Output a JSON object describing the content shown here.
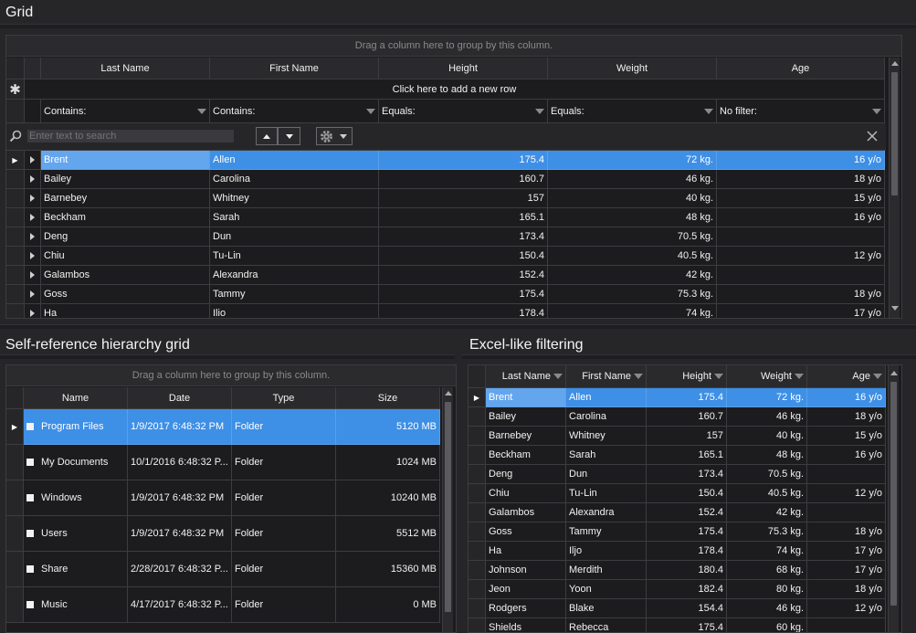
{
  "main_grid": {
    "title": "Grid",
    "group_hint": "Drag a column here to group by this column.",
    "columns": [
      "Last Name",
      "First Name",
      "Height",
      "Weight",
      "Age"
    ],
    "new_row": "Click here to add a new row",
    "filters": [
      "Contains:",
      "Contains:",
      "Equals:",
      "Equals:",
      "No filter:"
    ],
    "search_placeholder": "Enter text to search",
    "rows": [
      [
        "Brent",
        "Allen",
        "175.4",
        "72 kg.",
        "16 y/o"
      ],
      [
        "Bailey",
        "Carolina",
        "160.7",
        "46 kg.",
        "18 y/o"
      ],
      [
        "Barnebey",
        "Whitney",
        "157",
        "40 kg.",
        "15 y/o"
      ],
      [
        "Beckham",
        "Sarah",
        "165.1",
        "48 kg.",
        "16 y/o"
      ],
      [
        "Deng",
        "Dun",
        "173.4",
        "70.5 kg.",
        ""
      ],
      [
        "Chiu",
        "Tu-Lin",
        "150.4",
        "40.5 kg.",
        "12 y/o"
      ],
      [
        "Galambos",
        "Alexandra",
        "152.4",
        "42 kg.",
        ""
      ],
      [
        "Goss",
        "Tammy",
        "175.4",
        "75.3 kg.",
        "18 y/o"
      ],
      [
        "Ha",
        "Ilio",
        "178.4",
        "74 kg.",
        "17 y/o"
      ]
    ]
  },
  "hierarchy_grid": {
    "title": "Self-reference hierarchy grid",
    "group_hint": "Drag a column here to group by this column.",
    "columns": [
      "Name",
      "Date",
      "Type",
      "Size"
    ],
    "rows": [
      [
        "Program Files",
        "1/9/2017 6:48:32 PM",
        "Folder",
        "5120 MB"
      ],
      [
        "My Documents",
        "10/1/2016 6:48:32 P...",
        "Folder",
        "1024 MB"
      ],
      [
        "Windows",
        "1/9/2017 6:48:32 PM",
        "Folder",
        "10240 MB"
      ],
      [
        "Users",
        "1/9/2017 6:48:32 PM",
        "Folder",
        "5512 MB"
      ],
      [
        "Share",
        "2/28/2017 6:48:32 P...",
        "Folder",
        "15360 MB"
      ],
      [
        "Music",
        "4/17/2017 6:48:32 P...",
        "Folder",
        "0 MB"
      ]
    ]
  },
  "excel_grid": {
    "title": "Excel-like filtering",
    "columns": [
      "Last Name",
      "First Name",
      "Height",
      "Weight",
      "Age"
    ],
    "rows": [
      [
        "Brent",
        "Allen",
        "175.4",
        "72 kg.",
        "16 y/o"
      ],
      [
        "Bailey",
        "Carolina",
        "160.7",
        "46 kg.",
        "18 y/o"
      ],
      [
        "Barnebey",
        "Whitney",
        "157",
        "40 kg.",
        "15 y/o"
      ],
      [
        "Beckham",
        "Sarah",
        "165.1",
        "48 kg.",
        "16 y/o"
      ],
      [
        "Deng",
        "Dun",
        "173.4",
        "70.5 kg.",
        ""
      ],
      [
        "Chiu",
        "Tu-Lin",
        "150.4",
        "40.5 kg.",
        "12 y/o"
      ],
      [
        "Galambos",
        "Alexandra",
        "152.4",
        "42 kg.",
        ""
      ],
      [
        "Goss",
        "Tammy",
        "175.4",
        "75.3 kg.",
        "18 y/o"
      ],
      [
        "Ha",
        "Iljo",
        "178.4",
        "74 kg.",
        "17 y/o"
      ],
      [
        "Johnson",
        "Merdith",
        "180.4",
        "68 kg.",
        "17 y/o"
      ],
      [
        "Jeon",
        "Yoon",
        "182.4",
        "80 kg.",
        "18 y/o"
      ],
      [
        "Rodgers",
        "Blake",
        "154.4",
        "46 kg.",
        "12 y/o"
      ],
      [
        "Shields",
        "Rebecca",
        "175.4",
        "60 kg.",
        ""
      ]
    ]
  },
  "colors": {
    "background": "#262629",
    "grid": "#1c1c1e",
    "selection": "#3e8fe6"
  }
}
